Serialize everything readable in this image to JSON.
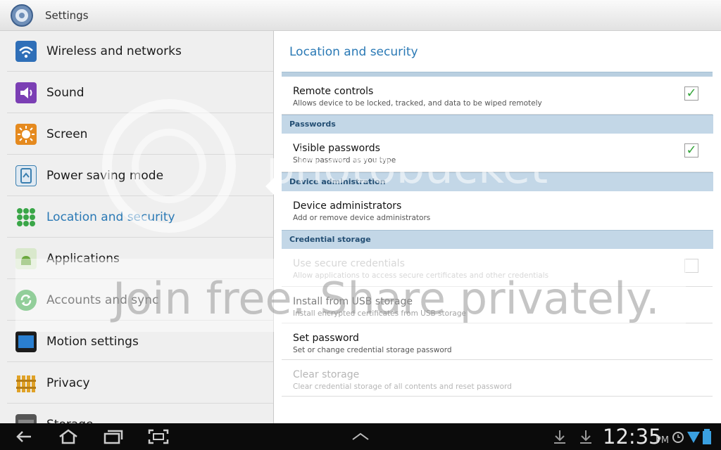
{
  "app": {
    "title": "Settings",
    "icon": "gear-icon"
  },
  "sidebar": {
    "items": [
      {
        "label": "Wireless and networks",
        "icon": "wifi-icon",
        "color": "#2f6fb8"
      },
      {
        "label": "Sound",
        "icon": "speaker-icon",
        "color": "#7b3fb4"
      },
      {
        "label": "Screen",
        "icon": "sun-icon",
        "color": "#e58a1f"
      },
      {
        "label": "Power saving mode",
        "icon": "recycle-icon",
        "color": "#3a7fb0"
      },
      {
        "label": "Location and security",
        "icon": "grid-icon",
        "color": "#3aa648"
      },
      {
        "label": "Applications",
        "icon": "android-icon",
        "color": "#6aa83c"
      },
      {
        "label": "Accounts and sync",
        "icon": "sync-icon",
        "color": "#3aa648"
      },
      {
        "label": "Motion settings",
        "icon": "tablet-icon",
        "color": "#2a7fd0"
      },
      {
        "label": "Privacy",
        "icon": "fence-icon",
        "color": "#e0a227"
      },
      {
        "label": "Storage",
        "icon": "storage-icon",
        "color": "#555555"
      }
    ],
    "active_index": 4
  },
  "panel": {
    "title": "Location and security",
    "remote": {
      "title": "Remote controls",
      "summary": "Allows device to be locked, tracked, and data to be wiped remotely",
      "checked": true
    },
    "cat_passwords": "Passwords",
    "visible": {
      "title": "Visible passwords",
      "summary": "Show password as you type",
      "checked": true
    },
    "cat_device_admin": "Device administration",
    "admins": {
      "title": "Device administrators",
      "summary": "Add or remove device administrators"
    },
    "cat_credential": "Credential storage",
    "secure": {
      "title": "Use secure credentials",
      "summary": "Allow applications to access secure certificates and other credentials",
      "checked": false
    },
    "install": {
      "title": "Install from USB storage",
      "summary": "Install encrypted certificates from USB storage"
    },
    "setpw": {
      "title": "Set password",
      "summary": "Set or change credential storage password"
    },
    "clear": {
      "title": "Clear storage",
      "summary": "Clear credential storage of all contents and reset password"
    }
  },
  "watermark": {
    "line1": "photobucket",
    "line2": "Join free. Share privately."
  },
  "statusbar": {
    "time": "12:35",
    "ampm": "PM"
  },
  "colors": {
    "accent": "#2a79b5",
    "category_bg": "#c3d7e7",
    "check": "#35a53a"
  }
}
